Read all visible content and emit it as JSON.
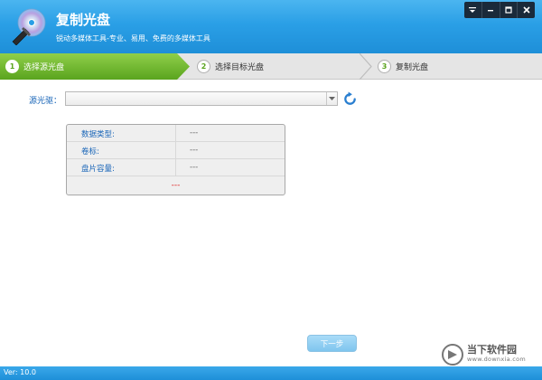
{
  "header": {
    "title": "复制光盘",
    "subtitle": "锐动多媒体工具-专业、易用、免费的多媒体工具",
    "window_controls": [
      "menu-icon",
      "minimize-icon",
      "maximize-icon",
      "close-icon"
    ]
  },
  "steps": [
    {
      "num": "1",
      "label": "选择源光盘",
      "active": true
    },
    {
      "num": "2",
      "label": "选择目标光盘",
      "active": false
    },
    {
      "num": "3",
      "label": "复制光盘",
      "active": false
    }
  ],
  "source": {
    "label": "源光驱：",
    "value": ""
  },
  "info": {
    "rows": [
      {
        "key": "数据类型:",
        "value": "---"
      },
      {
        "key": "卷标:",
        "value": "---"
      },
      {
        "key": "盘片容量:",
        "value": "---"
      }
    ],
    "status": "---"
  },
  "buttons": {
    "next_label": "下一步"
  },
  "watermark": {
    "text": "当下软件园",
    "url": "www.downxia.com"
  },
  "footer": {
    "version": "Ver: 10.0"
  },
  "colors": {
    "header_blue": "#2a9fe6",
    "step_active_green": "#5aa41e",
    "label_blue": "#1a66b8",
    "status_red": "#e02020"
  }
}
